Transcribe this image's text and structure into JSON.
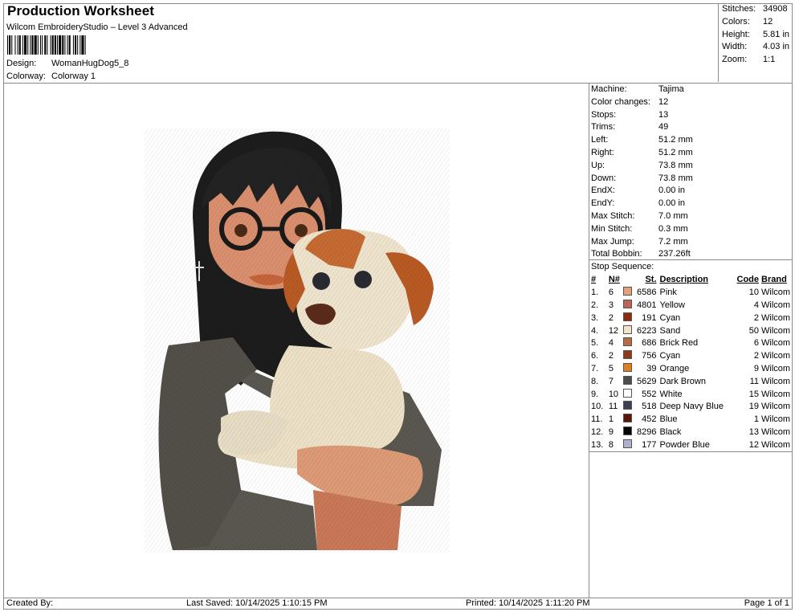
{
  "header": {
    "title": "Production Worksheet",
    "subtitle": "Wilcom EmbroideryStudio – Level 3 Advanced",
    "design_label": "Design:",
    "design_value": "WomanHugDog5_8",
    "colorway_label": "Colorway:",
    "colorway_value": "Colorway 1"
  },
  "stats": [
    {
      "label": "Stitches:",
      "value": "34908"
    },
    {
      "label": "Colors:",
      "value": "12"
    },
    {
      "label": "Height:",
      "value": "5.81 in"
    },
    {
      "label": "Width:",
      "value": "4.03 in"
    },
    {
      "label": "Zoom:",
      "value": "1:1"
    }
  ],
  "machine_info": [
    {
      "label": "Machine:",
      "value": "Tajima"
    },
    {
      "label": "Color changes:",
      "value": "12"
    },
    {
      "label": "Stops:",
      "value": "13"
    },
    {
      "label": "Trims:",
      "value": "49"
    },
    {
      "label": "Left:",
      "value": "51.2 mm"
    },
    {
      "label": "Right:",
      "value": "51.2 mm"
    },
    {
      "label": "Up:",
      "value": "73.8 mm"
    },
    {
      "label": "Down:",
      "value": "73.8 mm"
    },
    {
      "label": "EndX:",
      "value": "0.00 in"
    },
    {
      "label": "EndY:",
      "value": "0.00 in"
    },
    {
      "label": "Max Stitch:",
      "value": "7.0 mm"
    },
    {
      "label": "Min Stitch:",
      "value": "0.3 mm"
    },
    {
      "label": "Max Jump:",
      "value": "7.2 mm"
    },
    {
      "label": "Total Bobbin:",
      "value": "237.26ft"
    }
  ],
  "stop_sequence": {
    "title": "Stop Sequence:",
    "columns": {
      "num": "#",
      "n": "N#",
      "st": "St.",
      "desc": "Description",
      "code": "Code",
      "brand": "Brand"
    },
    "rows": [
      {
        "num": "1.",
        "n": "6",
        "color": "#e8a07c",
        "st": "6586",
        "desc": "Pink",
        "code": "10",
        "brand": "Wilcom"
      },
      {
        "num": "2.",
        "n": "3",
        "color": "#c0645a",
        "st": "4801",
        "desc": "Yellow",
        "code": "4",
        "brand": "Wilcom"
      },
      {
        "num": "3.",
        "n": "2",
        "color": "#8b2a0c",
        "st": "191",
        "desc": "Cyan",
        "code": "2",
        "brand": "Wilcom"
      },
      {
        "num": "4.",
        "n": "12",
        "color": "#f3e3c9",
        "st": "6223",
        "desc": "Sand",
        "code": "50",
        "brand": "Wilcom"
      },
      {
        "num": "5.",
        "n": "4",
        "color": "#b86a48",
        "st": "686",
        "desc": "Brick Red",
        "code": "6",
        "brand": "Wilcom"
      },
      {
        "num": "6.",
        "n": "2",
        "color": "#8e3a14",
        "st": "756",
        "desc": "Cyan",
        "code": "2",
        "brand": "Wilcom"
      },
      {
        "num": "7.",
        "n": "5",
        "color": "#e07f22",
        "st": "39",
        "desc": "Orange",
        "code": "9",
        "brand": "Wilcom"
      },
      {
        "num": "8.",
        "n": "7",
        "color": "#4d4d4d",
        "st": "5629",
        "desc": "Dark Brown",
        "code": "11",
        "brand": "Wilcom"
      },
      {
        "num": "9.",
        "n": "10",
        "color": "#ffffff",
        "st": "552",
        "desc": "White",
        "code": "15",
        "brand": "Wilcom"
      },
      {
        "num": "10.",
        "n": "11",
        "color": "#3b3f4e",
        "st": "518",
        "desc": "Deep Navy Blue",
        "code": "19",
        "brand": "Wilcom"
      },
      {
        "num": "11.",
        "n": "1",
        "color": "#5a1608",
        "st": "452",
        "desc": "Blue",
        "code": "1",
        "brand": "Wilcom"
      },
      {
        "num": "12.",
        "n": "9",
        "color": "#050505",
        "st": "8296",
        "desc": "Black",
        "code": "13",
        "brand": "Wilcom"
      },
      {
        "num": "13.",
        "n": "8",
        "color": "#aeb2d0",
        "st": "177",
        "desc": "Powder Blue",
        "code": "12",
        "brand": "Wilcom"
      }
    ]
  },
  "footer": {
    "created_by": "Created By:",
    "last_saved": "Last Saved: 10/14/2025 1:10:15 PM",
    "printed": "Printed: 10/14/2025 1:11:20 PM",
    "page": "Page 1 of 1"
  }
}
